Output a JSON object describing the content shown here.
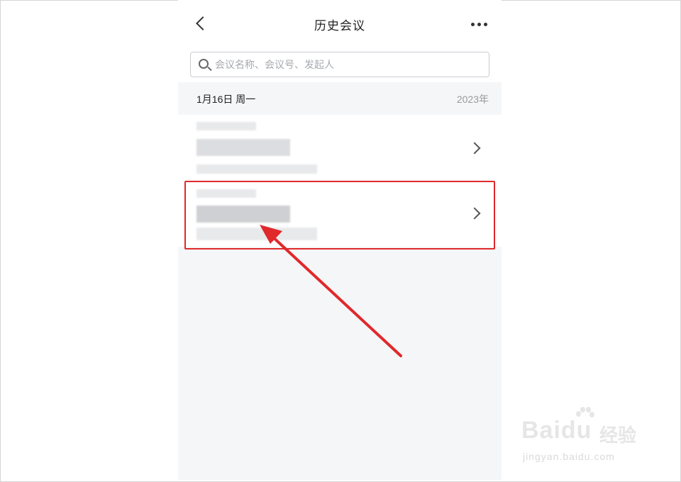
{
  "header": {
    "title": "历史会议",
    "back_icon": "chevron-left-icon",
    "more_icon": "more-horizontal-icon"
  },
  "search": {
    "placeholder": "会议名称、会议号、发起人",
    "value": "",
    "icon": "search-icon"
  },
  "section": {
    "date": "1月16日 周一",
    "year": "2023年"
  },
  "meetings": [
    {
      "item_icon": "chevron-right-icon"
    },
    {
      "item_icon": "chevron-right-icon"
    }
  ],
  "annotation": {
    "highlight_color": "#e0292b",
    "arrow_color": "#e0292b"
  },
  "watermark": {
    "brand": "Baidu",
    "product": "经验",
    "url": "jingyan.baidu.com"
  }
}
